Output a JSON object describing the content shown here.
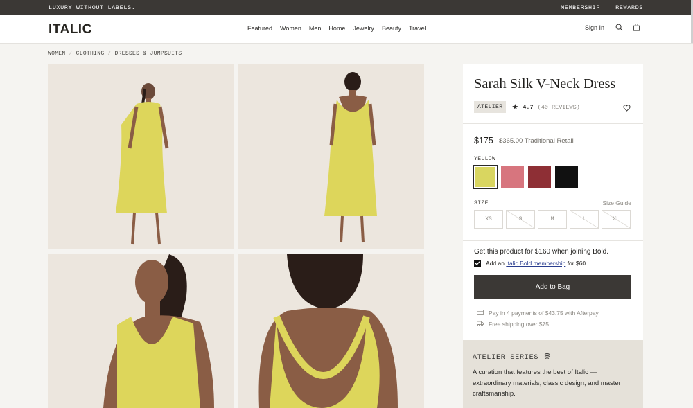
{
  "promo": {
    "left": "LUXURY WITHOUT LABELS.",
    "membership": "MEMBERSHIP",
    "rewards": "REWARDS"
  },
  "nav": {
    "logo": "ITALIC",
    "menu": [
      "Featured",
      "Women",
      "Men",
      "Home",
      "Jewelry",
      "Beauty",
      "Travel"
    ],
    "sign_in": "Sign In",
    "icons": [
      "search-icon",
      "bag-icon"
    ]
  },
  "breadcrumb": [
    "WOMEN",
    "CLOTHING",
    "DRESSES & JUMPSUITS"
  ],
  "product": {
    "title": "Sarah Silk V-Neck Dress",
    "badge": "ATELIER",
    "rating": "4.7",
    "reviews": "(40 REVIEWS)",
    "price": "$175",
    "retail": "$365.00 Traditional Retail",
    "color_label": "YELLOW",
    "colors": [
      {
        "name": "Yellow",
        "hex": "#d9d660",
        "selected": true
      },
      {
        "name": "Pink",
        "hex": "#d7757e",
        "selected": false
      },
      {
        "name": "Red",
        "hex": "#8e2f35",
        "selected": false
      },
      {
        "name": "Black",
        "hex": "#111111",
        "selected": false
      }
    ],
    "size_label": "SIZE",
    "size_guide": "Size Guide",
    "sizes": [
      "XS",
      "S",
      "M",
      "L",
      "XL"
    ],
    "bold_offer": "Get this product for $160 when joining Bold.",
    "add_an": "Add an",
    "bold_link": "Italic Bold membership",
    "bold_for": "for $60",
    "add_to_bag": "Add to Bag",
    "afterpay": "Pay in 4 payments of $43.75 with Afterpay",
    "shipping": "Free shipping over $75"
  },
  "atelier": {
    "title": "ATELIER SERIES",
    "desc": "A curation that features the best of Italic — extraordinary materials, classic design, and master craftsmanship."
  }
}
